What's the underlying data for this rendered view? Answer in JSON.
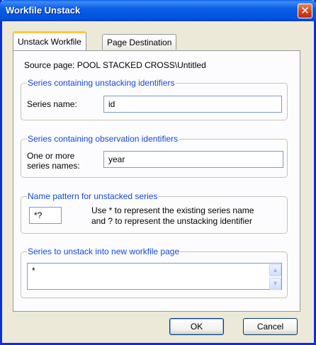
{
  "window": {
    "title": "Workfile Unstack",
    "close_glyph": "✕"
  },
  "tabs": [
    {
      "label": "Unstack Workfile",
      "active": true
    },
    {
      "label": "Page Destination",
      "active": false
    }
  ],
  "source_page": "Source page: POOL STACKED CROSS\\Untitled",
  "groups": {
    "unstacking": {
      "legend": "Series containing unstacking identifiers",
      "field_label": "Series name:",
      "value": "id"
    },
    "observation": {
      "legend": "Series containing observation identifiers",
      "label_line1": "One or more",
      "label_line2": "series names:",
      "value": "year"
    },
    "pattern": {
      "legend": "Name pattern for unstacked series",
      "value": "*?",
      "help_line1": "Use * to represent the existing series name",
      "help_line2": "and ? to represent the unstacking identifier"
    },
    "unstack": {
      "legend": "Series to unstack into new workfile page",
      "value": "*"
    }
  },
  "buttons": {
    "ok": "OK",
    "cancel": "Cancel"
  }
}
